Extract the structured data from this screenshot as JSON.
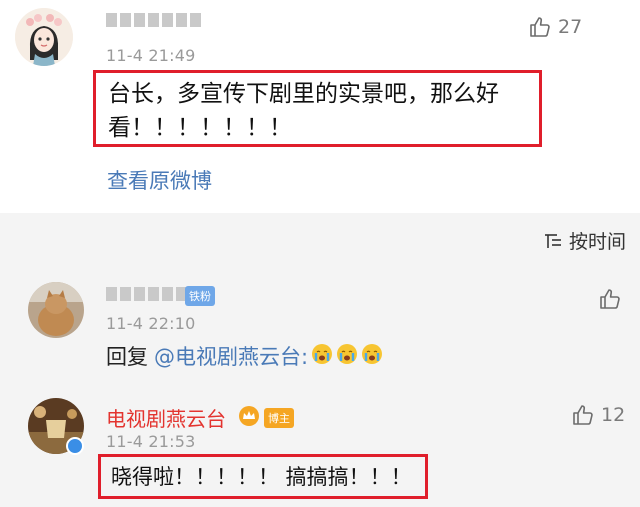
{
  "comment1": {
    "time": "11-4 21:49",
    "like_count": "27",
    "text_line1": "台长，多宣传下剧里的实景吧，那么好",
    "text_line2": "看！！！！！！！",
    "view_original_label": "查看原微博"
  },
  "sort": {
    "label": "按时间",
    "icon": "sort-icon"
  },
  "reply1": {
    "badge": "铁粉",
    "time": "11-4 22:10",
    "reply_prefix": "回复",
    "mention": "@电视剧燕云台:",
    "emojis": [
      "crying-face",
      "crying-face",
      "crying-face"
    ]
  },
  "reply2": {
    "author": "电视剧燕云台",
    "badge": "博主",
    "time": "11-4 21:53",
    "like_count": "12",
    "text": "晓得啦！！！！！ 搞搞搞！！！"
  },
  "colors": {
    "highlight": "#e01e2b",
    "link": "#4a7ab7",
    "author": "#e3342f"
  }
}
